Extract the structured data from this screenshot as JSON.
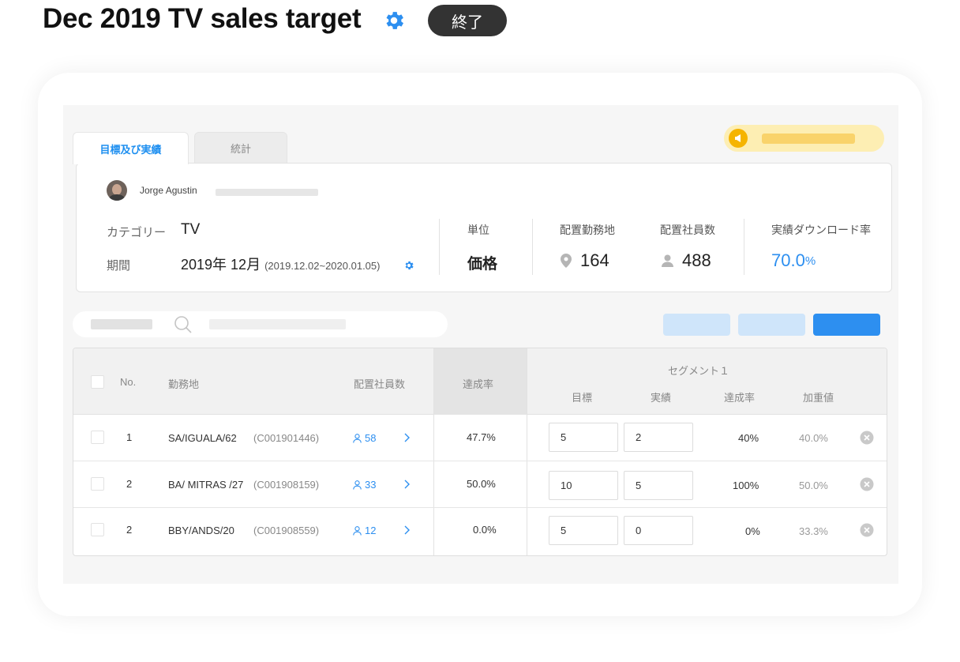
{
  "header": {
    "title": "Dec 2019 TV sales target",
    "status": "終了"
  },
  "tabs": [
    {
      "label": "目標及び実績"
    },
    {
      "label": "統計"
    }
  ],
  "user": {
    "name": "Jorge Agustin"
  },
  "info": {
    "category_label": "カテゴリー",
    "category_value": "TV",
    "period_label": "期間",
    "period_value": "2019年 12月",
    "period_range": "(2019.12.02~2020.01.05)"
  },
  "stats": [
    {
      "label": "単位",
      "value": "価格"
    },
    {
      "label": "配置勤務地",
      "value": "164"
    },
    {
      "label": "配置社員数",
      "value": "488"
    },
    {
      "label": "実績ダウンロード率",
      "value": "70.0",
      "unit": "%"
    }
  ],
  "table": {
    "headers": {
      "no": "No.",
      "location": "勤務地",
      "employees": "配置社員数",
      "rate": "達成率",
      "segment": "セグメント１",
      "target": "目標",
      "actual": "実績",
      "seg_rate": "達成率",
      "weight": "加重値"
    },
    "rows": [
      {
        "no": "1",
        "location": "SA/IGUALA/62",
        "code": "(C001901446)",
        "employees": "58",
        "rate": "47.7%",
        "target": "5",
        "actual": "2",
        "seg_rate": "40%",
        "weight": "40.0%"
      },
      {
        "no": "2",
        "location": "BA/ MITRAS /27",
        "code": "(C001908159)",
        "employees": "33",
        "rate": "50.0%",
        "target": "10",
        "actual": "5",
        "seg_rate": "100%",
        "weight": "50.0%"
      },
      {
        "no": "2",
        "location": "BBY/ANDS/20",
        "code": "(C001908559)",
        "employees": "12",
        "rate": "0.0%",
        "target": "5",
        "actual": "0",
        "seg_rate": "0%",
        "weight": "33.3%"
      }
    ]
  },
  "icons": {
    "title_gear": "gear-icon",
    "notice": "megaphone-icon",
    "location": "map-pin-icon",
    "person": "person-icon",
    "search": "search-icon",
    "chevron": "chevron-right-icon",
    "delete": "close-circle-icon"
  },
  "colors": {
    "accent": "#2d8ff0",
    "status_pill": "#333333",
    "notice_bg": "#fdeeb3",
    "notice_icon": "#f5b400"
  }
}
